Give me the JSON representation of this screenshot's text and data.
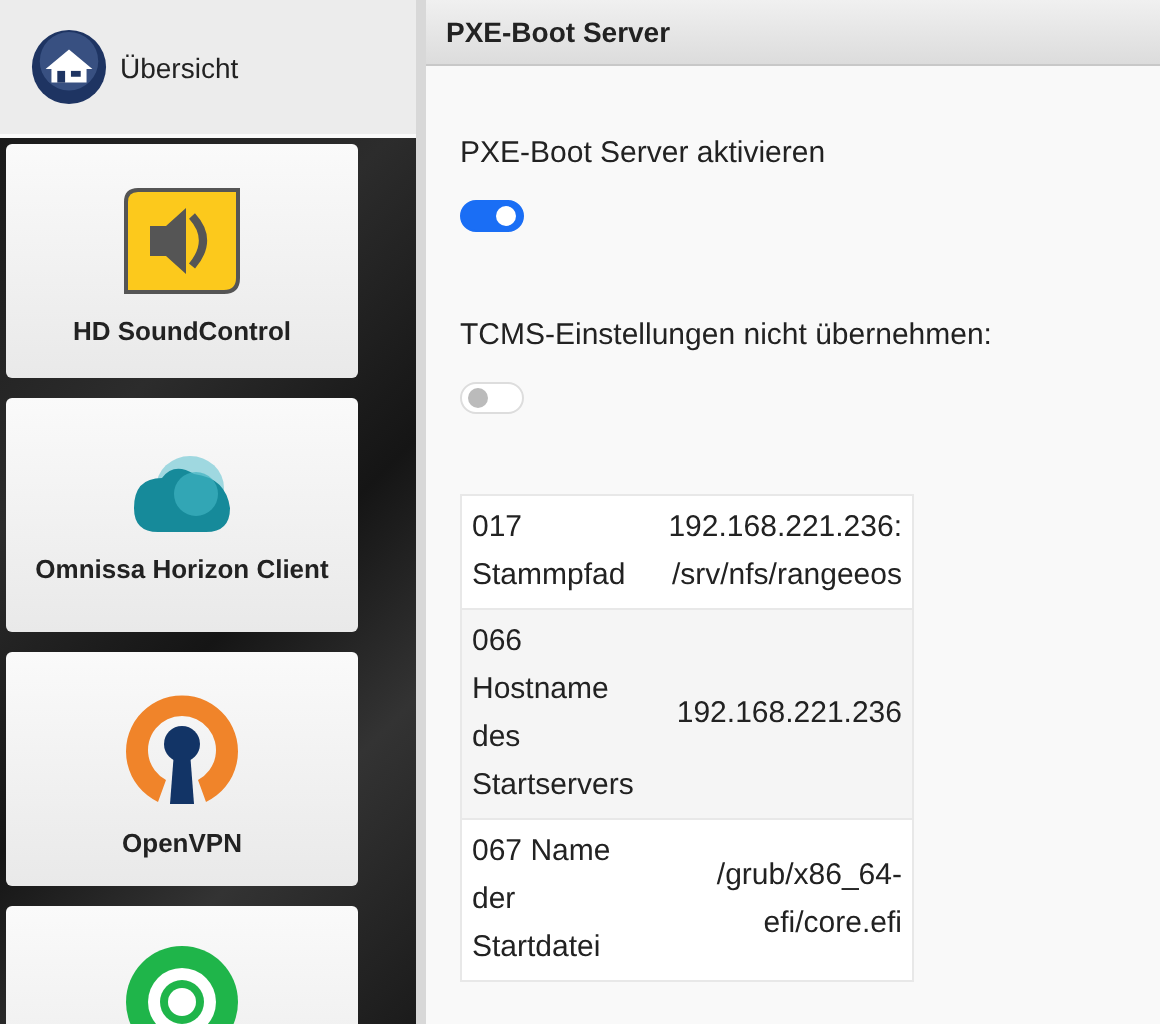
{
  "sidebar": {
    "home": {
      "label": "Übersicht"
    },
    "tiles": [
      {
        "kind": "app",
        "label": "HD SoundControl"
      },
      {
        "kind": "app",
        "label": "Omnissa Horizon Client"
      },
      {
        "kind": "app",
        "label": "OpenVPN"
      },
      {
        "kind": "cut"
      }
    ]
  },
  "panel": {
    "title": "PXE-Boot Server",
    "settings": [
      {
        "label": "PXE-Boot Server aktivieren",
        "on": true
      },
      {
        "label": "TCMS-Einstellungen nicht übernehmen:",
        "on": false
      }
    ],
    "table": {
      "rows": [
        {
          "name": "017 Stammpfad",
          "value": "192.168.221.236:/srv/nfs/rangeeos"
        },
        {
          "name": "066 Hostname des Startservers",
          "value": "192.168.221.236"
        },
        {
          "name": "067 Name der Startdatei",
          "value": "/grub/x86_64-efi/core.efi"
        }
      ]
    }
  }
}
